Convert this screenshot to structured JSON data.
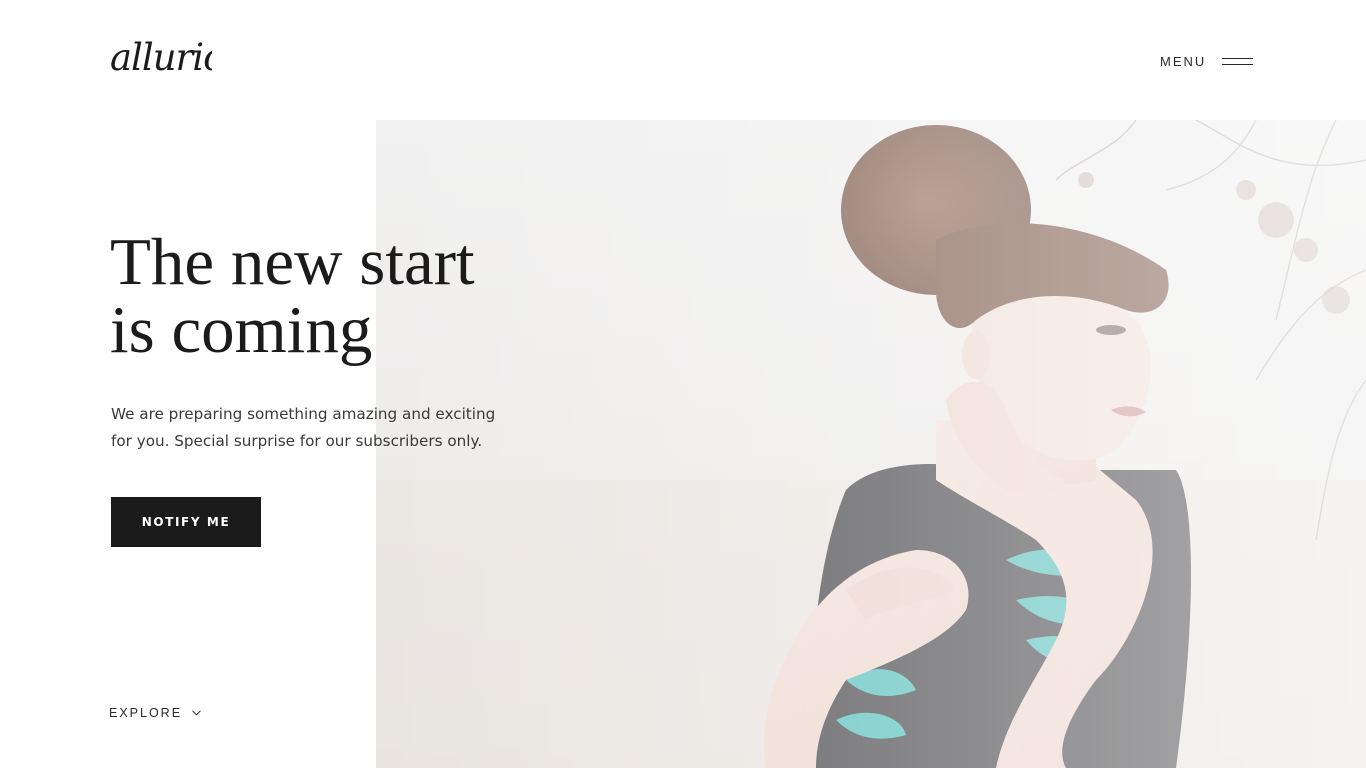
{
  "header": {
    "logo_text": "allurio",
    "menu_label": "MENU",
    "menu_icon": "hamburger-icon"
  },
  "hero": {
    "headline_line1": "The new start",
    "headline_line2": "is coming",
    "subtext_line1": "We are preparing something amazing and exciting",
    "subtext_line2": "for you. Special surprise for our subscribers only.",
    "button_label": "NOTIFY ME",
    "explore_label": "EXPLORE",
    "explore_icon": "chevron-down-icon"
  },
  "colors": {
    "text": "#1b1b1b",
    "button_bg": "#1b1b1b",
    "button_text": "#ffffff",
    "background": "#ffffff"
  }
}
